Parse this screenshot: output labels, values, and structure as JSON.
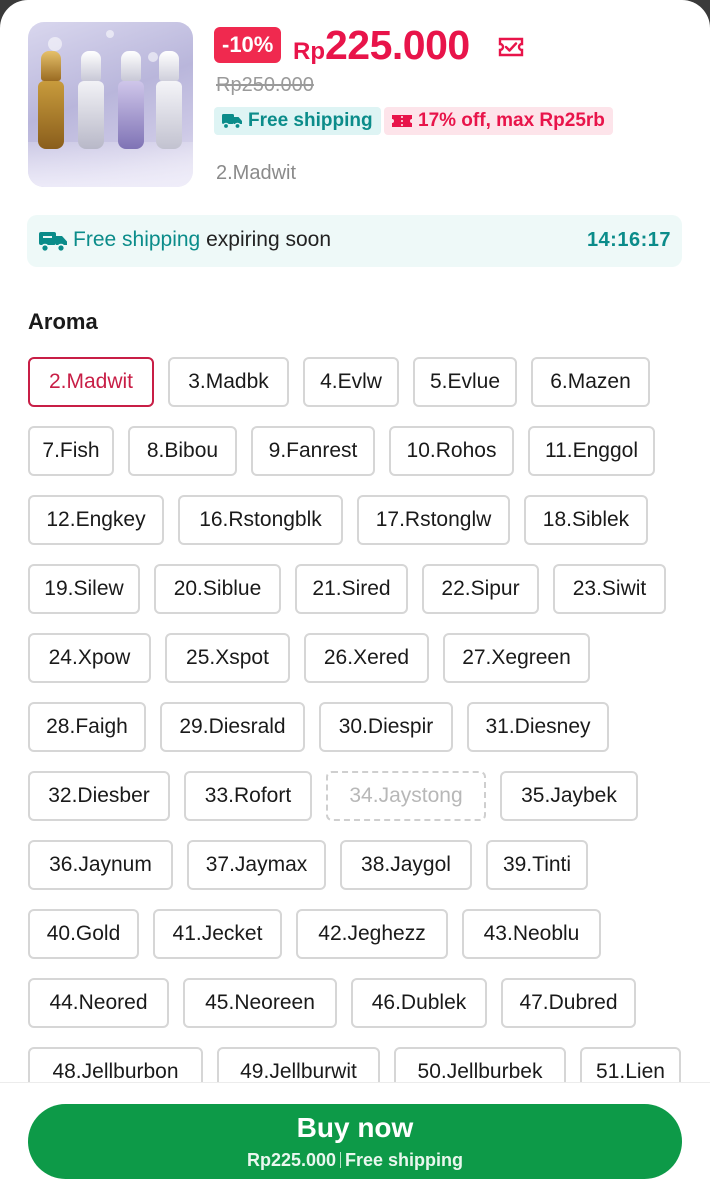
{
  "product": {
    "discount_badge": "-10%",
    "currency": "Rp",
    "price": "225.000",
    "original_price": "Rp250.000",
    "free_shipping_chip": "Free shipping",
    "voucher_chip": "17% off, max Rp25rb",
    "selected_variant": "2.Madwit",
    "accent_color": "#e8144a",
    "icons": [
      "ticket-check-icon",
      "truck-icon",
      "voucher-icon"
    ]
  },
  "banner": {
    "highlight": "Free shipping",
    "text": " expiring soon",
    "timer": "14:16:17",
    "color": "#0b8c8a",
    "icon": "truck-icon"
  },
  "aroma": {
    "title": "Aroma",
    "options": [
      {
        "label": "2.Madwit",
        "state": "selected"
      },
      {
        "label": "3.Madbk",
        "state": "available"
      },
      {
        "label": "4.Evlw",
        "state": "available"
      },
      {
        "label": "5.Evlue",
        "state": "available"
      },
      {
        "label": "6.Mazen",
        "state": "available"
      },
      {
        "label": "7.Fish",
        "state": "available"
      },
      {
        "label": "8.Bibou",
        "state": "available"
      },
      {
        "label": "9.Fanrest",
        "state": "available"
      },
      {
        "label": "10.Rohos",
        "state": "available"
      },
      {
        "label": "11.Enggol",
        "state": "available"
      },
      {
        "label": "12.Engkey",
        "state": "available"
      },
      {
        "label": "16.Rstongblk",
        "state": "available"
      },
      {
        "label": "17.Rstonglw",
        "state": "available"
      },
      {
        "label": "18.Siblek",
        "state": "available"
      },
      {
        "label": "19.Silew",
        "state": "available"
      },
      {
        "label": "20.Siblue",
        "state": "available"
      },
      {
        "label": "21.Sired",
        "state": "available"
      },
      {
        "label": "22.Sipur",
        "state": "available"
      },
      {
        "label": "23.Siwit",
        "state": "available"
      },
      {
        "label": "24.Xpow",
        "state": "available"
      },
      {
        "label": "25.Xspot",
        "state": "available"
      },
      {
        "label": "26.Xered",
        "state": "available"
      },
      {
        "label": "27.Xegreen",
        "state": "available"
      },
      {
        "label": "28.Faigh",
        "state": "available"
      },
      {
        "label": "29.Diesrald",
        "state": "available"
      },
      {
        "label": "30.Diespir",
        "state": "available"
      },
      {
        "label": "31.Diesney",
        "state": "available"
      },
      {
        "label": "32.Diesber",
        "state": "available"
      },
      {
        "label": "33.Rofort",
        "state": "available"
      },
      {
        "label": "34.Jaystong",
        "state": "disabled"
      },
      {
        "label": "35.Jaybek",
        "state": "available"
      },
      {
        "label": "36.Jaynum",
        "state": "available"
      },
      {
        "label": "37.Jaymax",
        "state": "available"
      },
      {
        "label": "38.Jaygol",
        "state": "available"
      },
      {
        "label": "39.Tinti",
        "state": "available"
      },
      {
        "label": "40.Gold",
        "state": "available"
      },
      {
        "label": "41.Jecket",
        "state": "available"
      },
      {
        "label": "42.Jeghezz",
        "state": "available"
      },
      {
        "label": "43.Neoblu",
        "state": "available"
      },
      {
        "label": "44.Neored",
        "state": "available"
      },
      {
        "label": "45.Neoreen",
        "state": "available"
      },
      {
        "label": "46.Dublek",
        "state": "available"
      },
      {
        "label": "47.Dubred",
        "state": "available"
      },
      {
        "label": "48.Jellburbon",
        "state": "available"
      },
      {
        "label": "49.Jellburwit",
        "state": "available"
      },
      {
        "label": "50.Jellburbek",
        "state": "available"
      },
      {
        "label": "51.Lien",
        "state": "available"
      }
    ]
  },
  "buy": {
    "label": "Buy now",
    "price": "Rp225.000",
    "shipping": "Free shipping",
    "color": "#0d9a48"
  }
}
